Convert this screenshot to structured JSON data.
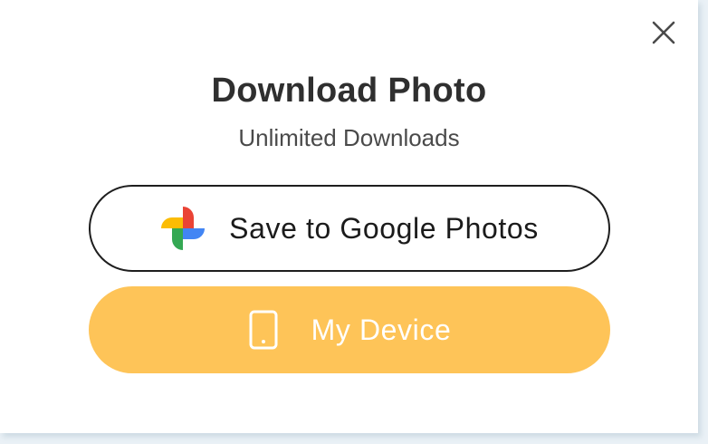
{
  "dialog": {
    "title": "Download Photo",
    "subtitle": "Unlimited Downloads",
    "close_icon": "close-icon"
  },
  "buttons": {
    "google": {
      "label": "Save to Google Photos",
      "icon": "google-photos-icon"
    },
    "device": {
      "label": "My Device",
      "icon": "phone-icon"
    }
  },
  "colors": {
    "device_button_bg": "#fec458",
    "google_button_border": "#1e1e1e",
    "title_text": "#2f2f2f",
    "google_red": "#ea4335",
    "google_blue": "#4285f4",
    "google_green": "#34a853",
    "google_yellow": "#fbbc04"
  }
}
